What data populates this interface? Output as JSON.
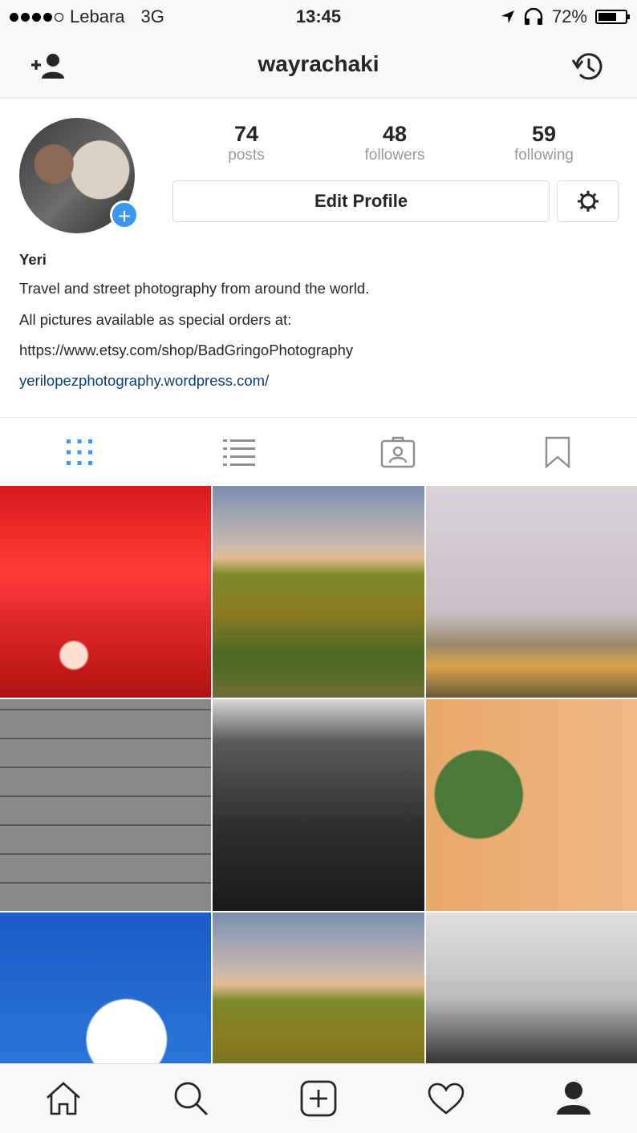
{
  "status_bar": {
    "carrier": "Lebara",
    "network": "3G",
    "time": "13:45",
    "battery": "72%",
    "battery_level": 0.72,
    "signal_bars": 4,
    "signal_max": 5
  },
  "header": {
    "username": "wayrachaki",
    "left_icon": "add-person-icon",
    "right_icon": "history-icon"
  },
  "profile": {
    "stats": [
      {
        "value": "74",
        "label": "posts"
      },
      {
        "value": "48",
        "label": "followers"
      },
      {
        "value": "59",
        "label": "following"
      }
    ],
    "edit_button": "Edit Profile",
    "settings_icon": "gear-icon"
  },
  "bio": {
    "name": "Yeri",
    "lines": [
      "Travel and street photography from around the world.",
      "All pictures available as special orders at:",
      "https://www.etsy.com/shop/BadGringoPhotography"
    ],
    "link": "yerilopezphotography.wordpress.com/"
  },
  "tabs": [
    "grid-icon",
    "list-icon",
    "tagged-icon",
    "bookmark-icon"
  ],
  "grid_posts": 9,
  "bottom_nav": [
    "home-icon",
    "search-icon",
    "add-post-icon",
    "heart-icon",
    "profile-icon"
  ],
  "colors": {
    "accent": "#3897f0",
    "link": "#0a3d74",
    "muted": "#999999",
    "border": "#dbdbdb"
  }
}
